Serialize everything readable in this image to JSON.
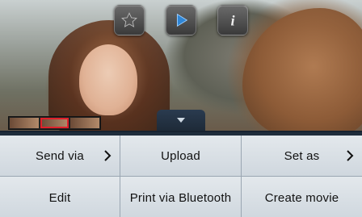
{
  "toolbar": {
    "buttons": [
      {
        "icon": "star-icon"
      },
      {
        "icon": "play-icon"
      },
      {
        "icon": "info-icon"
      }
    ]
  },
  "menu": {
    "items": [
      {
        "label": "Send via",
        "has_submenu": true
      },
      {
        "label": "Upload",
        "has_submenu": false
      },
      {
        "label": "Set as",
        "has_submenu": true
      },
      {
        "label": "Edit",
        "has_submenu": false
      },
      {
        "label": "Print via Bluetooth",
        "has_submenu": false
      },
      {
        "label": "Create movie",
        "has_submenu": false
      }
    ]
  },
  "colors": {
    "menu_bg": "#1f2d3c",
    "cell_bg": "#dde3e8",
    "play_accent": "#2f86d6",
    "filmstrip_selected": "#e0212b"
  }
}
